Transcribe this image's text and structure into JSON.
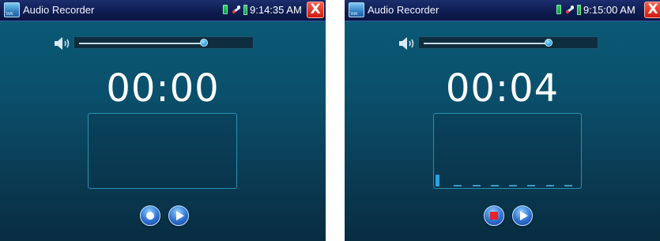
{
  "screens": [
    {
      "app_title": "Audio Recorder",
      "clock": "9:14:35 AM",
      "close_label": "X",
      "volume_level": 0.72,
      "timer": "00:00",
      "state": "idle",
      "waveform": []
    },
    {
      "app_title": "Audio Recorder",
      "clock": "9:15:00 AM",
      "close_label": "X",
      "volume_level": 0.72,
      "timer": "00:04",
      "state": "recording",
      "waveform": [
        0.16,
        0.02,
        0.02,
        0.02,
        0.02,
        0.02,
        0.02,
        0.02
      ]
    }
  ],
  "icons": {
    "app": "tape-recorder-icon",
    "battery": "battery-icon",
    "usb": "usb-icon",
    "signal": "signal-icon",
    "close": "close-icon",
    "volume": "speaker-icon",
    "record": "record-icon",
    "stop": "stop-icon",
    "play": "play-icon"
  },
  "colors": {
    "background_top": "#0b5c78",
    "background_bottom": "#082c40",
    "titlebar": "#0f1d52",
    "close_button": "#d11a10",
    "accent": "#2aa3e0",
    "stop": "#e8232a"
  }
}
